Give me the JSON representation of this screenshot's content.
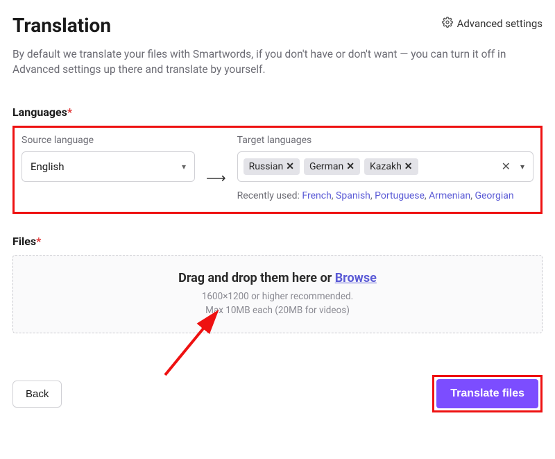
{
  "header": {
    "title": "Translation",
    "advanced_settings": "Advanced settings"
  },
  "description": "By default we translate your files with Smartwords, if you don't have or don't want — you can turn it off in Advanced settings up there and translate by yourself.",
  "languages": {
    "section_label": "Languages",
    "source_label": "Source language",
    "source_value": "English",
    "arrow": "⟶",
    "target_label": "Target languages",
    "chips": [
      "Russian",
      "German",
      "Kazakh"
    ],
    "recent_label": "Recently used: ",
    "recent": [
      "French",
      "Spanish",
      "Portuguese",
      "Armenian",
      "Georgian"
    ]
  },
  "files": {
    "section_label": "Files",
    "dz_text": "Drag and drop them here or ",
    "dz_link": "Browse",
    "dz_sub1": "1600×1200 or higher recommended.",
    "dz_sub2": "Max 10MB each (20MB for videos)"
  },
  "footer": {
    "back": "Back",
    "translate": "Translate files"
  }
}
